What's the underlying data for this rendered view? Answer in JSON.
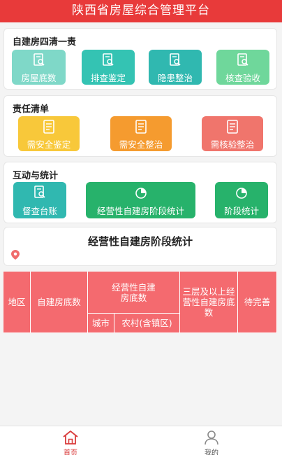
{
  "app": {
    "title": "陕西省房屋综合管理平台"
  },
  "colors": {
    "primary": "#e83a3a",
    "table_header": "#f46a6f"
  },
  "section1": {
    "title": "自建房四清一责",
    "tiles": [
      {
        "label": "房屋底数",
        "icon": "document-search-icon"
      },
      {
        "label": "排查鉴定",
        "icon": "document-search-icon"
      },
      {
        "label": "隐患整治",
        "icon": "document-search-icon"
      },
      {
        "label": "核查验收",
        "icon": "document-search-icon"
      }
    ]
  },
  "section2": {
    "title": "责任清单",
    "tiles": [
      {
        "label": "需安全鉴定",
        "icon": "document-list-icon"
      },
      {
        "label": "需安全整治",
        "icon": "document-list-icon"
      },
      {
        "label": "需核验整治",
        "icon": "document-list-icon"
      }
    ]
  },
  "section3": {
    "title": "互动与统计",
    "tiles": [
      {
        "label": "督查台账",
        "icon": "document-search-icon"
      },
      {
        "label": "经营性自建房阶段统计",
        "icon": "pie-chart-icon"
      },
      {
        "label": "阶段统计",
        "icon": "pie-chart-icon"
      }
    ]
  },
  "stats": {
    "title": "经营性自建房阶段统计",
    "location_icon": "location-pin-icon",
    "table": {
      "col_region": "地区",
      "col_total": "自建房底数",
      "col_business_group": "经营性自建房底数",
      "col_city": "城市",
      "col_rural": "农村(含镇区)",
      "col_three_floor": "三层及以上经营性自建房底数",
      "col_pending": "待完善"
    }
  },
  "tabbar": {
    "tabs": [
      {
        "label": "首页",
        "icon": "home-icon",
        "active": true
      },
      {
        "label": "我的",
        "icon": "user-icon",
        "active": false
      }
    ]
  }
}
